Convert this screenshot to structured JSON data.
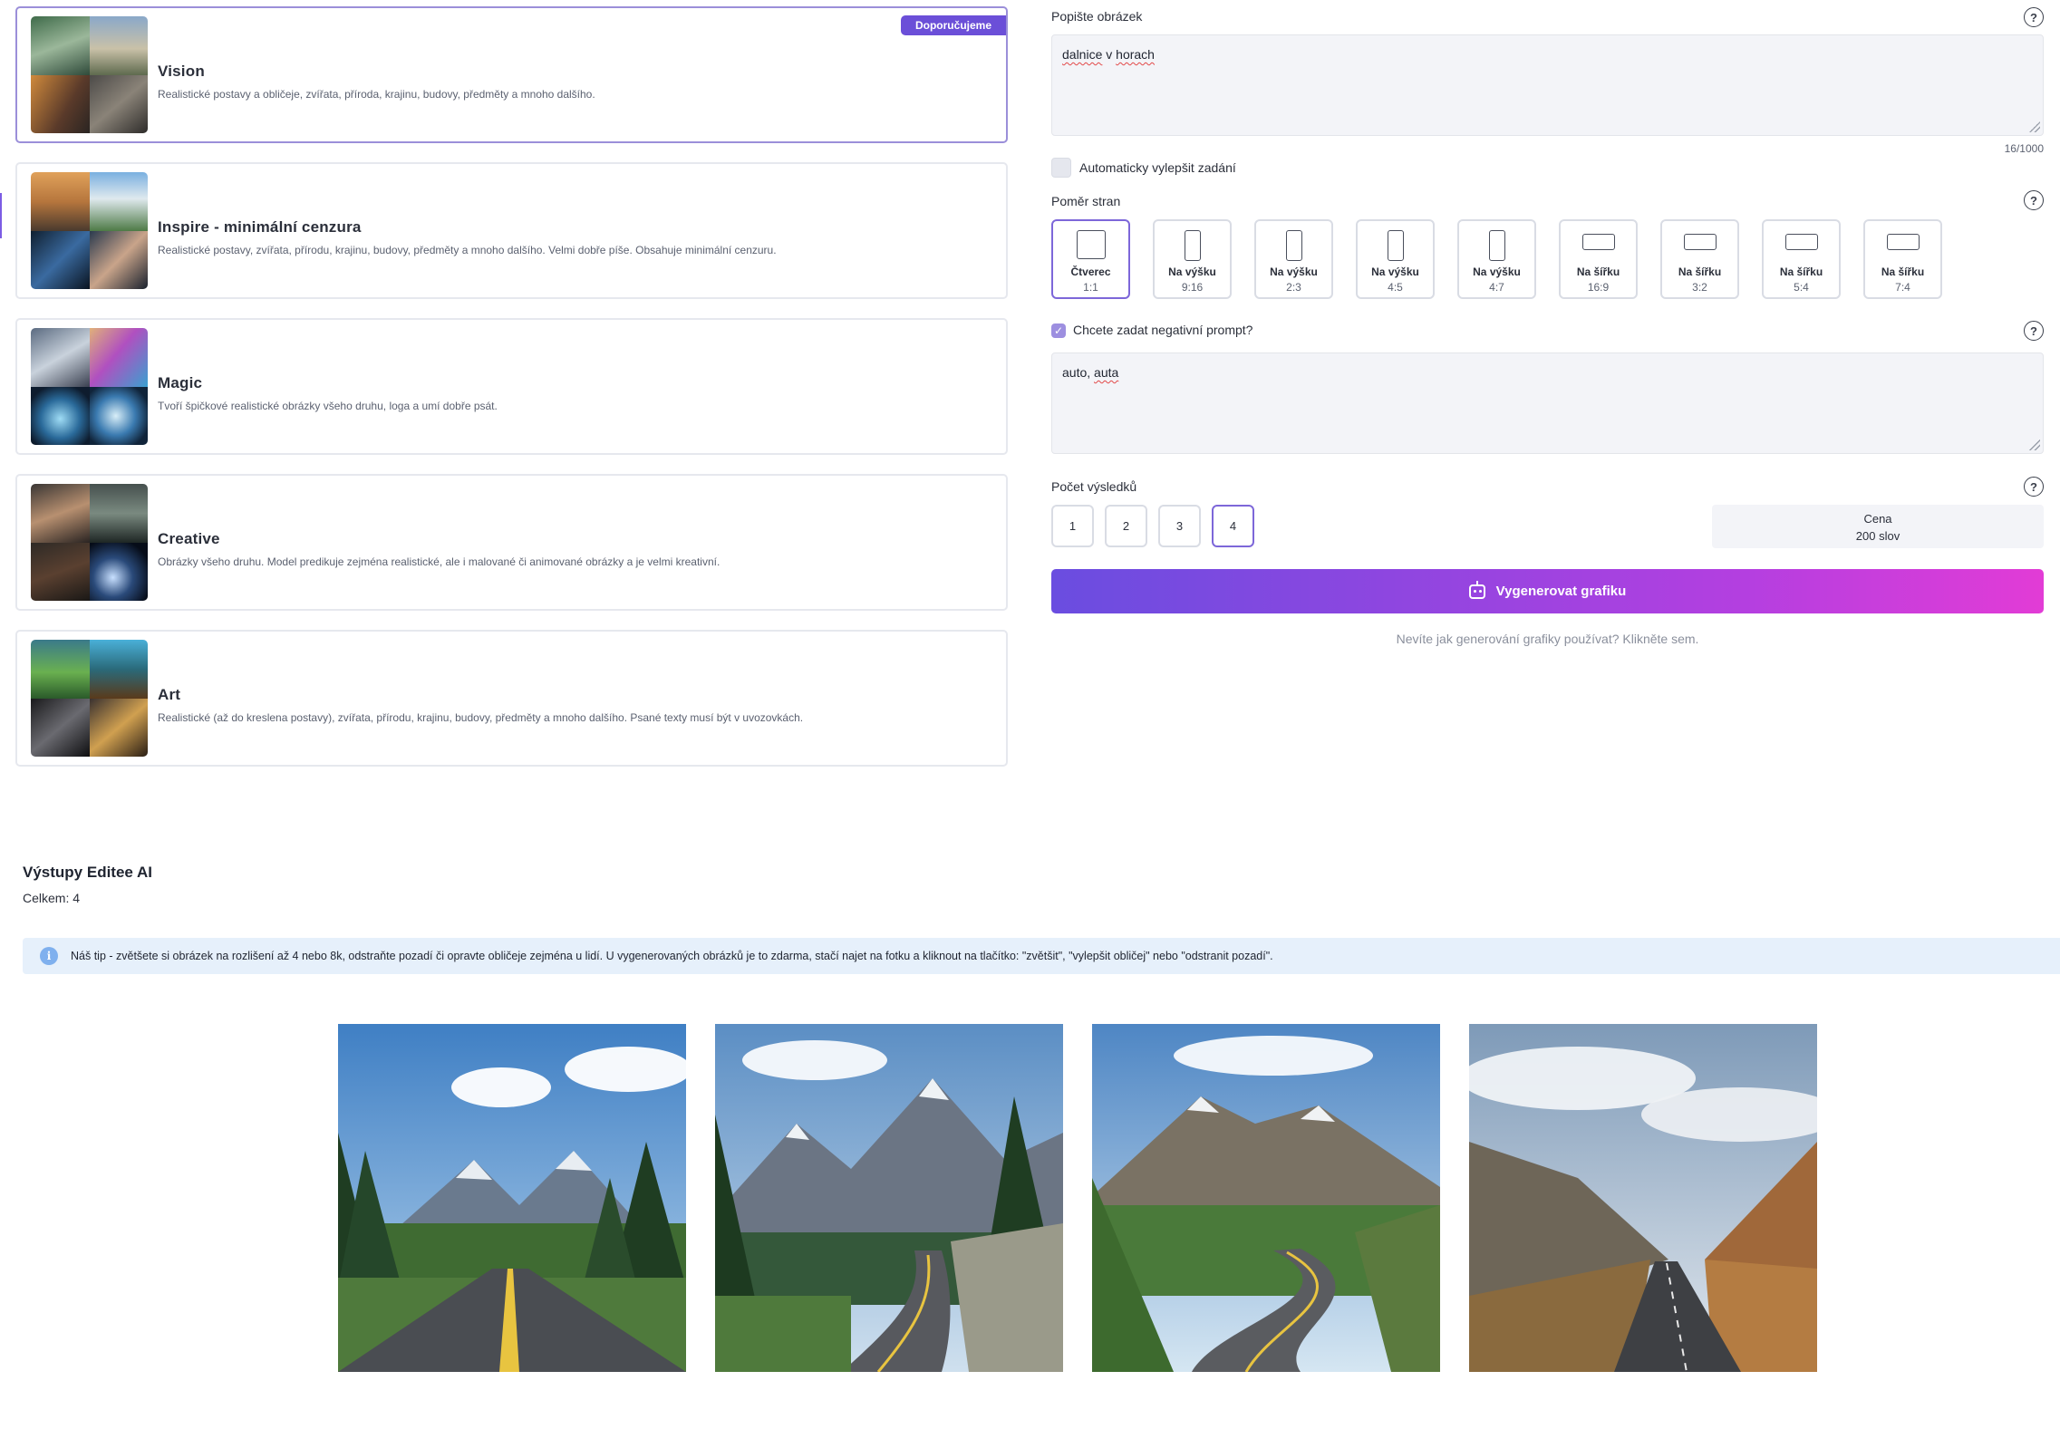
{
  "models": {
    "badge": "Doporučujeme",
    "items": [
      {
        "name": "Vision",
        "desc": "Realistické postavy a obličeje, zvířata, příroda, krajinu, budovy, předměty a mnoho dalšího."
      },
      {
        "name": "Inspire - minimální cenzura",
        "desc": "Realistické postavy, zvířata, přírodu, krajinu, budovy, předměty a mnoho dalšího. Velmi dobře píše. Obsahuje minimální cenzuru."
      },
      {
        "name": "Magic",
        "desc": "Tvoří špičkové realistické obrázky všeho druhu, loga a umí dobře psát."
      },
      {
        "name": "Creative",
        "desc": "Obrázky všeho druhu. Model predikuje zejména realistické, ale i malované či animované obrázky a je velmi kreativní."
      },
      {
        "name": "Art",
        "desc": "Realistické (až do kreslena postavy), zvířata, přírodu, krajinu, budovy, předměty a mnoho dalšího. Psané texty musí být v uvozovkách."
      }
    ]
  },
  "prompt": {
    "label": "Popište obrázek",
    "value_word1": "dalnice",
    "value_word2": "v",
    "value_word3": "horach",
    "counter": "16/1000",
    "auto_improve_label": "Automaticky vylepšit zadání"
  },
  "aspect": {
    "label": "Poměr stran",
    "options": [
      {
        "name": "Čtverec",
        "value": "1:1"
      },
      {
        "name": "Na výšku",
        "value": "9:16"
      },
      {
        "name": "Na výšku",
        "value": "2:3"
      },
      {
        "name": "Na výšku",
        "value": "4:5"
      },
      {
        "name": "Na výšku",
        "value": "4:7"
      },
      {
        "name": "Na šířku",
        "value": "16:9"
      },
      {
        "name": "Na šířku",
        "value": "3:2"
      },
      {
        "name": "Na šířku",
        "value": "5:4"
      },
      {
        "name": "Na šířku",
        "value": "7:4"
      }
    ]
  },
  "negative": {
    "label": "Chcete zadat negativní prompt?",
    "value_a": "auto,",
    "value_b": "auta"
  },
  "results_count": {
    "label": "Počet výsledků",
    "options": [
      "1",
      "2",
      "3",
      "4"
    ],
    "selected": "4"
  },
  "price": {
    "label": "Cena",
    "value": "200 slov"
  },
  "generate_label": "Vygenerovat grafiku",
  "help_link": "Nevíte jak generování grafiky používat? Klikněte sem.",
  "outputs": {
    "title": "Výstupy Editee AI",
    "total": "Celkem: 4",
    "tip": "Náš tip - zvětšete si obrázek na rozlišení až 4 nebo 8k, odstraňte pozadí či opravte obličeje zejména u lidí. U vygenerovaných obrázků je to zdarma, stačí najet na fotku a kliknout na tlačítko: \"zvětšit\", \"vylepšit obličej\" nebo \"odstranit pozadí\"."
  },
  "colors": {
    "accent": "#6b4fd8",
    "gradient_end": "#e23cd6",
    "tip_bg": "#e6f0fb"
  }
}
